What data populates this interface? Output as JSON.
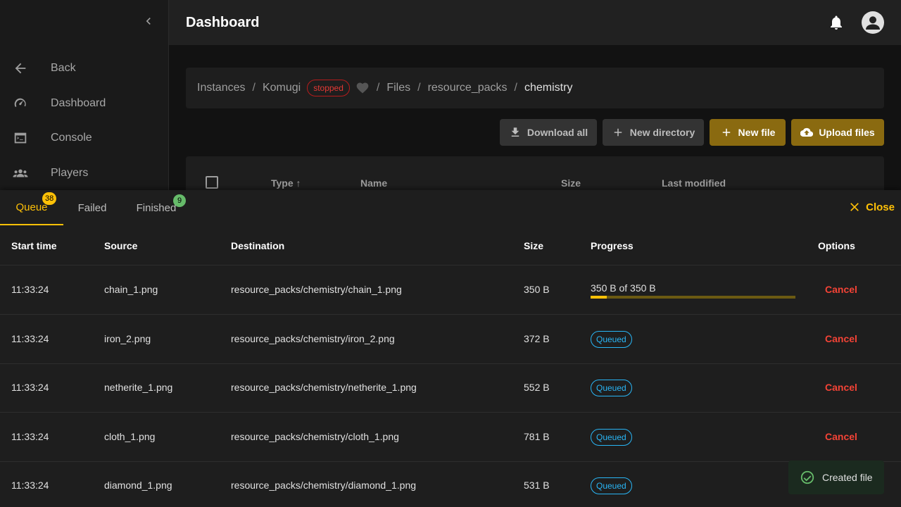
{
  "sidebar": {
    "items": [
      {
        "label": "Back",
        "icon": "arrow-left-icon"
      },
      {
        "label": "Dashboard",
        "icon": "speedometer-icon"
      },
      {
        "label": "Console",
        "icon": "console-icon"
      },
      {
        "label": "Players",
        "icon": "players-icon"
      }
    ]
  },
  "header": {
    "title": "Dashboard"
  },
  "breadcrumb": {
    "instances": "Instances",
    "instance": "Komugi",
    "status": "stopped",
    "files": "Files",
    "folder": "resource_packs",
    "current": "chemistry",
    "sep": "/"
  },
  "actions": {
    "download_all": "Download all",
    "new_directory": "New directory",
    "new_file": "New file",
    "upload_files": "Upload files"
  },
  "files_table": {
    "columns": [
      "Type",
      "Name",
      "Size",
      "Last modified"
    ]
  },
  "uploads": {
    "tabs": [
      {
        "label": "Queue",
        "count": "38"
      },
      {
        "label": "Failed"
      },
      {
        "label": "Finished",
        "count": "9"
      }
    ],
    "close_label": "Close",
    "columns": [
      "Start time",
      "Source",
      "Destination",
      "Size",
      "Progress",
      "Options"
    ],
    "rows": [
      {
        "start": "11:33:24",
        "source": "chain_1.png",
        "destination": "resource_packs/chemistry/chain_1.png",
        "size": "350 B",
        "progress_text": "350 B of 350 B",
        "progress_fraction": 0.08,
        "option": "Cancel"
      },
      {
        "start": "11:33:24",
        "source": "iron_2.png",
        "destination": "resource_packs/chemistry/iron_2.png",
        "size": "372 B",
        "status": "Queued",
        "option": "Cancel"
      },
      {
        "start": "11:33:24",
        "source": "netherite_1.png",
        "destination": "resource_packs/chemistry/netherite_1.png",
        "size": "552 B",
        "status": "Queued",
        "option": "Cancel"
      },
      {
        "start": "11:33:24",
        "source": "cloth_1.png",
        "destination": "resource_packs/chemistry/cloth_1.png",
        "size": "781 B",
        "status": "Queued",
        "option": "Cancel"
      },
      {
        "start": "11:33:24",
        "source": "diamond_1.png",
        "destination": "resource_packs/chemistry/diamond_1.png",
        "size": "531 B",
        "status": "Queued"
      }
    ]
  },
  "toast": {
    "message": "Created file"
  },
  "colors": {
    "accent": "#ffc107",
    "danger": "#f44336",
    "queued": "#29b6f6",
    "success": "#66bb6a"
  }
}
